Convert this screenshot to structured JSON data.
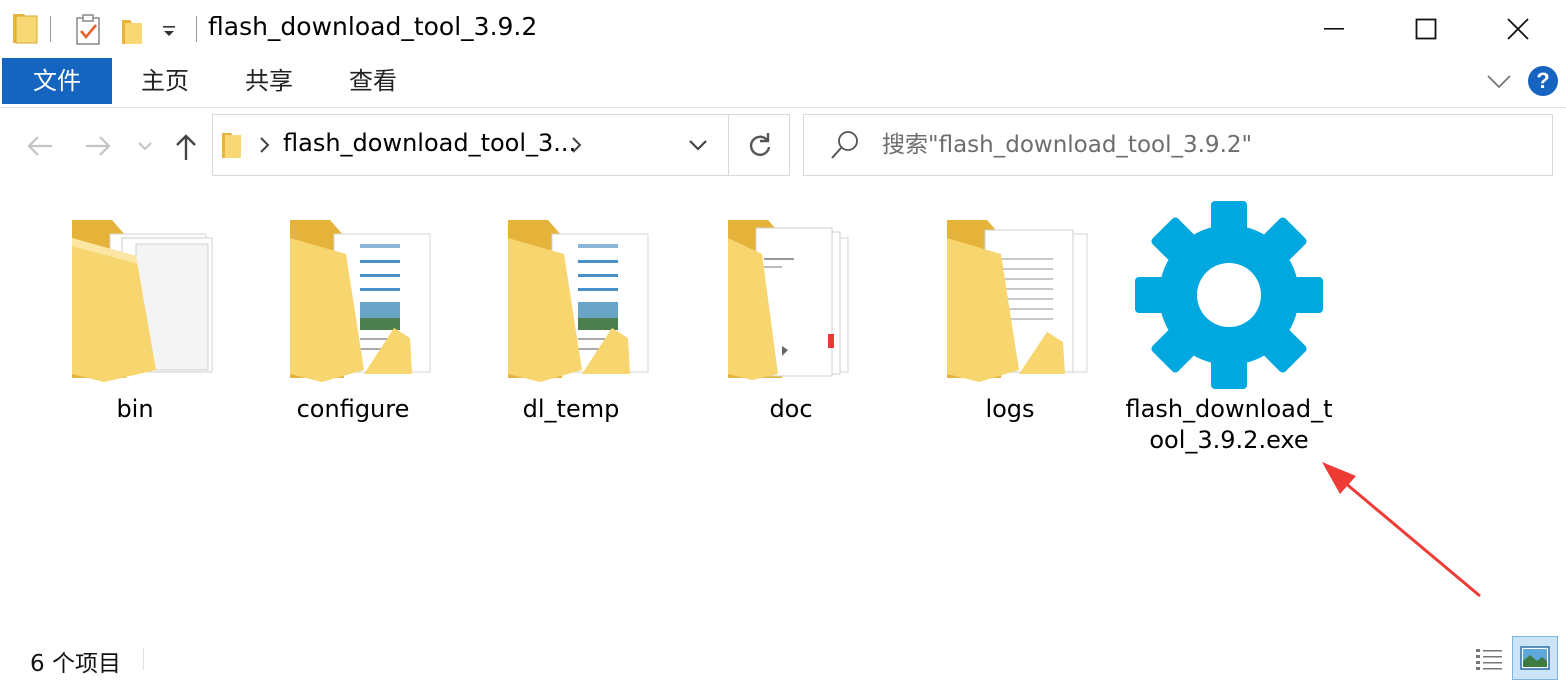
{
  "window": {
    "title": "flash_download_tool_3.9.2"
  },
  "ribbon": {
    "tabs": [
      {
        "label": "文件"
      },
      {
        "label": "主页"
      },
      {
        "label": "共享"
      },
      {
        "label": "查看"
      }
    ],
    "help_label": "?"
  },
  "address_bar": {
    "crumb": "flash_download_tool_3..."
  },
  "search": {
    "placeholder": "搜索\"flash_download_tool_3.9.2\""
  },
  "items": [
    {
      "name": "bin",
      "type": "folder"
    },
    {
      "name": "configure",
      "type": "folder"
    },
    {
      "name": "dl_temp",
      "type": "folder"
    },
    {
      "name": "doc",
      "type": "folder"
    },
    {
      "name": "logs",
      "type": "folder"
    },
    {
      "name": "flash_download_tool_3.9.2.exe",
      "type": "application",
      "icon": "gear-icon"
    }
  ],
  "status_bar": {
    "item_count": "6 个项目"
  },
  "colors": {
    "accent": "#1565c0",
    "folder": "#f8d775",
    "gear": "#00a8e0",
    "annotation": "#ee3b36"
  }
}
